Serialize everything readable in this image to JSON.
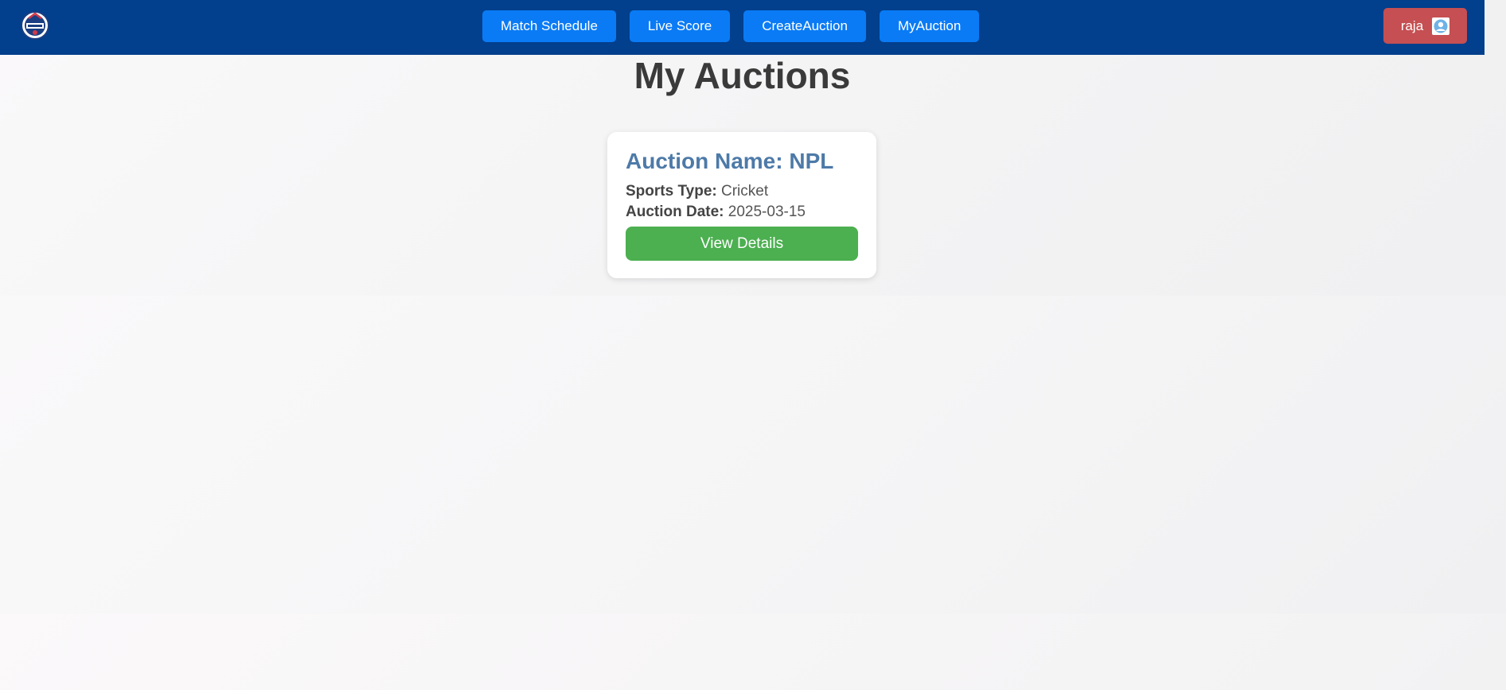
{
  "header": {
    "logo_icon": "cricket-logo-icon",
    "nav": [
      {
        "label": "Match Schedule"
      },
      {
        "label": "Live Score"
      },
      {
        "label": "CreateAuction"
      },
      {
        "label": "MyAuction"
      }
    ],
    "user": {
      "name": "raja",
      "avatar_icon": "user-avatar-icon"
    },
    "colors": {
      "navbar": "#023f8c",
      "nav_button": "#0a7bf5",
      "user_button": "#c54f52"
    }
  },
  "main": {
    "title": "My Auctions",
    "auctions": [
      {
        "name_label": "Auction Name: NPL",
        "sports_type_label": "Sports Type:",
        "sports_type": "Cricket",
        "date_label": "Auction Date:",
        "date": "2025-03-15",
        "button_label": "View Details"
      }
    ],
    "colors": {
      "card_title": "#4d7aa8",
      "view_button": "#4caf50"
    }
  }
}
